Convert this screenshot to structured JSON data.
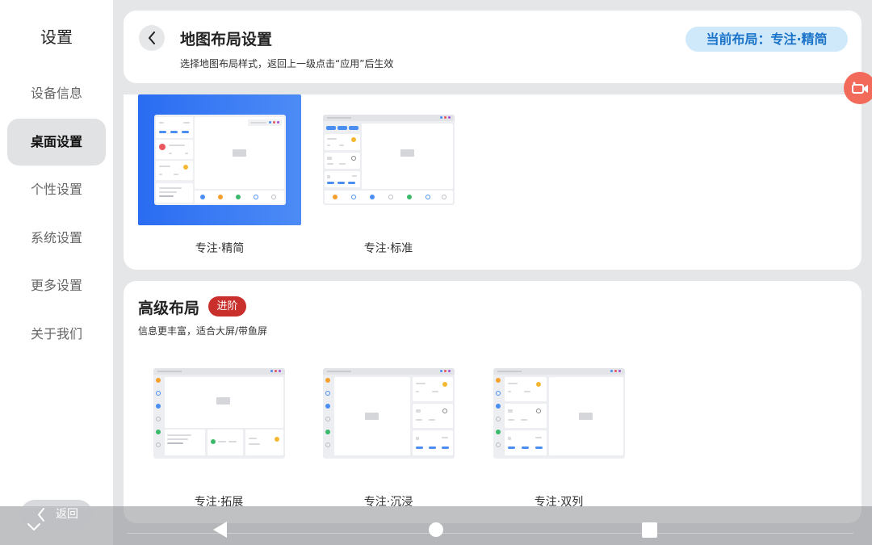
{
  "sidebar": {
    "title": "设置",
    "items": [
      {
        "label": "设备信息",
        "active": false
      },
      {
        "label": "桌面设置",
        "active": true
      },
      {
        "label": "个性设置",
        "active": false
      },
      {
        "label": "系统设置",
        "active": false
      },
      {
        "label": "更多设置",
        "active": false
      },
      {
        "label": "关于我们",
        "active": false
      }
    ]
  },
  "header": {
    "title": "地图布局设置",
    "subtitle": "选择地图布局样式，返回上一级点击“应用”后生效",
    "current_layout": "当前布局：专注·精简"
  },
  "basic_layouts": [
    {
      "label": "专注·精简",
      "selected": true
    },
    {
      "label": "专注·标准",
      "selected": false
    }
  ],
  "advanced": {
    "title": "高级布局",
    "badge": "进阶",
    "subtitle": "信息更丰富，适合大屏/带鱼屏",
    "layouts": [
      {
        "label": "专注·拓展"
      },
      {
        "label": "专注·沉浸"
      },
      {
        "label": "专注·双列"
      }
    ]
  },
  "nav": {
    "return_label": "返回"
  },
  "colors": {
    "accent": "#2a6cf2",
    "badge": "#c9302c",
    "pill_bg": "#cfe9fb",
    "pill_text": "#1a73c8",
    "camera": "#f26b5a"
  }
}
